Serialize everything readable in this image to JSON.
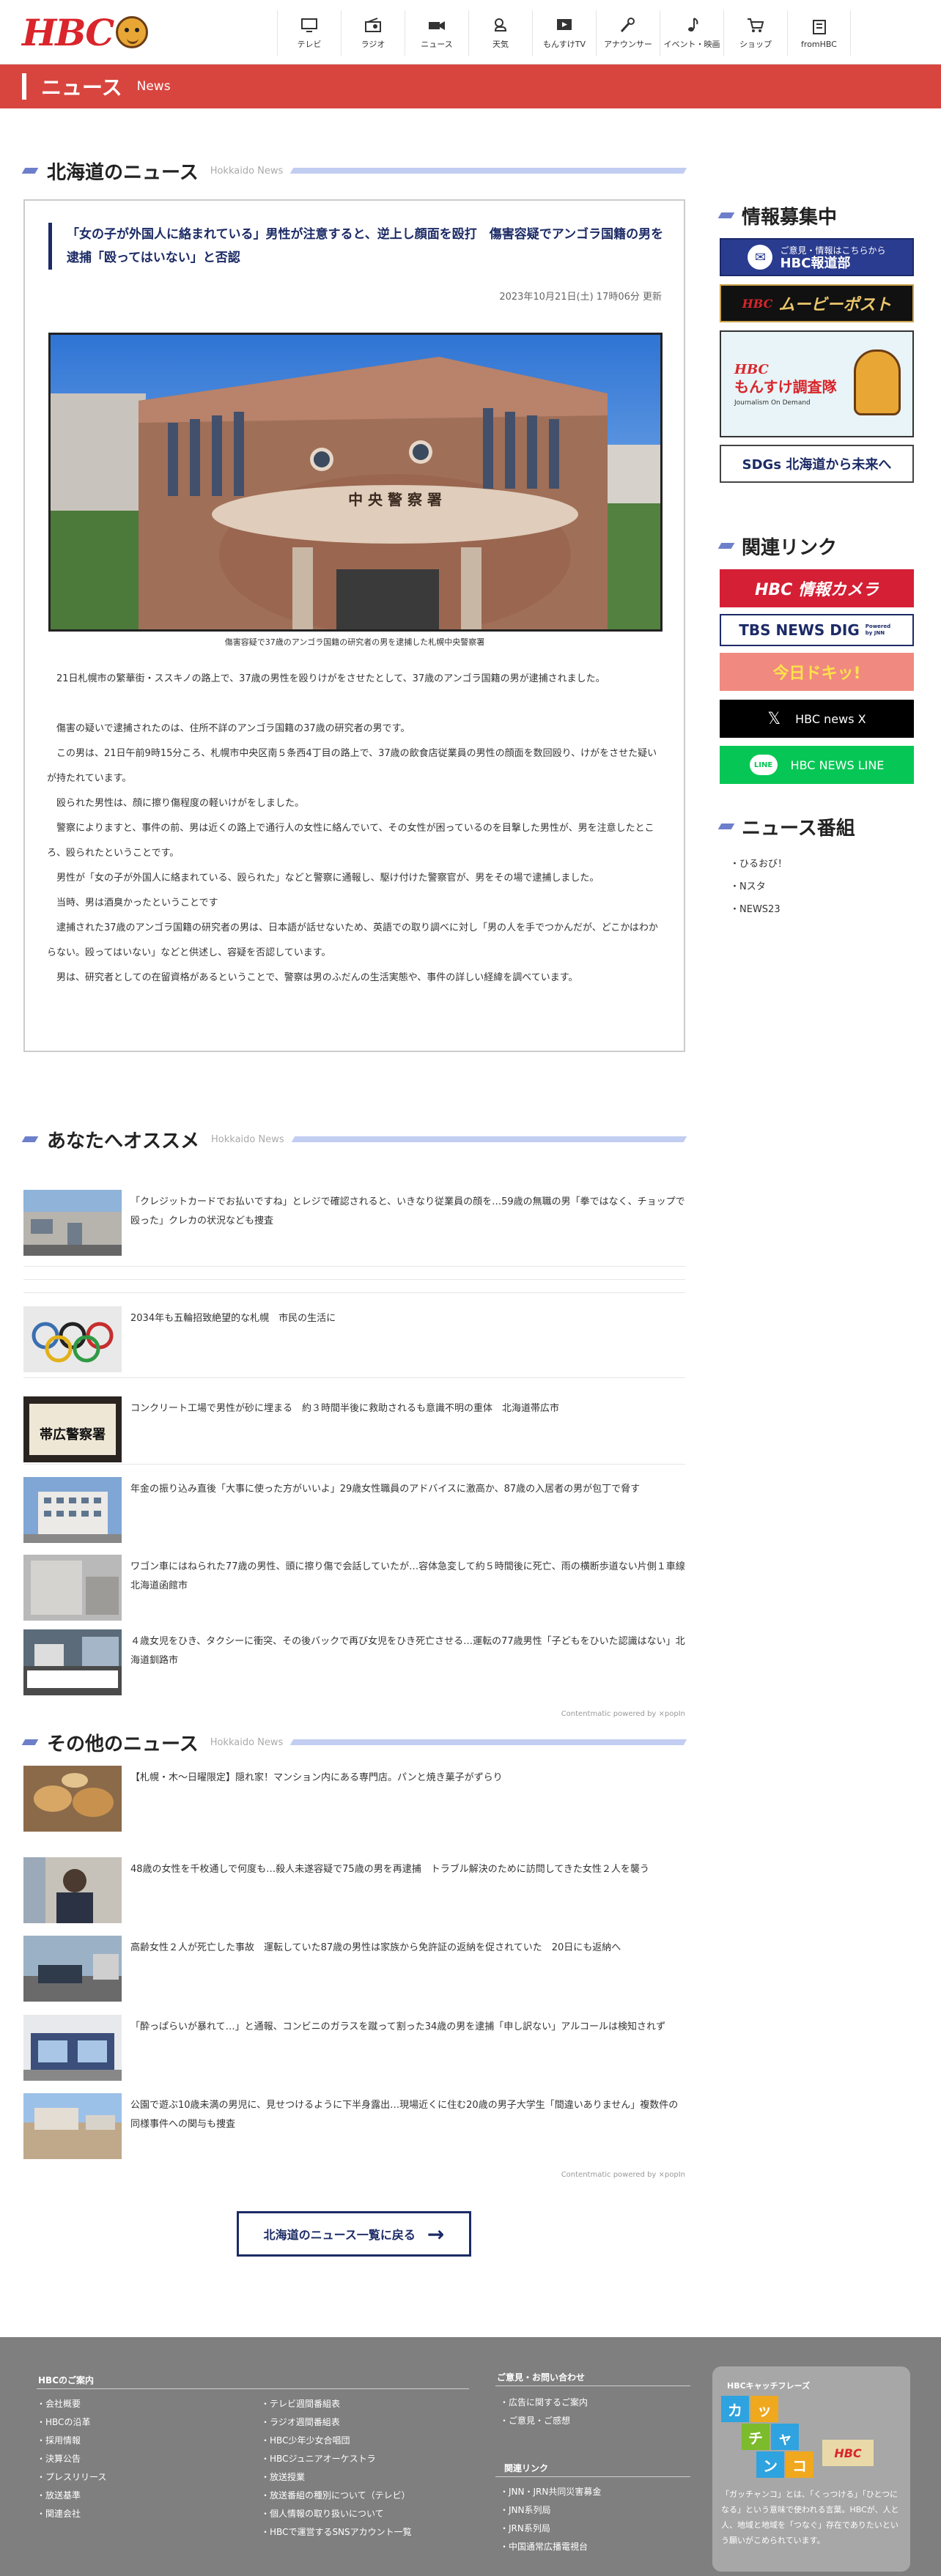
{
  "header": {
    "logo": "HBC",
    "nav": [
      {
        "label": "テレビ",
        "icon": "tv-icon"
      },
      {
        "label": "ラジオ",
        "icon": "radio-icon"
      },
      {
        "label": "ニュース",
        "icon": "news-camera-icon"
      },
      {
        "label": "天気",
        "icon": "weather-icon"
      },
      {
        "label": "もんすけTV",
        "icon": "monsuke-tv-icon"
      },
      {
        "label": "アナウンサー",
        "icon": "microphone-icon"
      },
      {
        "label": "イベント・映画",
        "icon": "music-note-icon"
      },
      {
        "label": "ショップ",
        "icon": "shopping-cart-icon"
      },
      {
        "label": "fromHBC",
        "icon": "document-icon"
      }
    ]
  },
  "page_banner": {
    "title": "ニュース",
    "subtitle": "News"
  },
  "hokkaido_news": {
    "title": "北海道のニュース",
    "subtitle": "Hokkaido News"
  },
  "article": {
    "title": "「女の子が外国人に絡まれている」男性が注意すると、逆上し顔面を殴打　傷害容疑でアンゴラ国籍の男を逮捕「殴ってはいない」と否認",
    "date": "2023年10月21日(土) 17時06分 更新",
    "photo_sign": "中 央 警 察 署",
    "caption": "傷害容疑で37歳のアンゴラ国籍の研究者の男を逮捕した札幌中央警察署",
    "paragraphs": [
      "21日札幌市の繁華街・ススキノの路上で、37歳の男性を殴りけがをさせたとして、37歳のアンゴラ国籍の男が逮捕されました。",
      "",
      "傷害の疑いで逮捕されたのは、住所不詳のアンゴラ国籍の37歳の研究者の男です。",
      "この男は、21日午前9時15分ころ、札幌市中央区南５条西4丁目の路上で、37歳の飲食店従業員の男性の顔面を数回殴り、けがをさせた疑いが持たれています。",
      "殴られた男性は、顔に擦り傷程度の軽いけがをしました。",
      "警察によりますと、事件の前、男は近くの路上で通行人の女性に絡んでいて、その女性が困っているのを目撃した男性が、男を注意したところ、殴られたということです。",
      "男性が「女の子が外国人に絡まれている、殴られた」などと警察に通報し、駆け付けた警察官が、男をその場で逮捕しました。",
      "当時、男は酒臭かったということです",
      "逮捕された37歳のアンゴラ国籍の研究者の男は、日本語が話せないため、英語での取り調べに対し「男の人を手でつかんだが、どこかはわからない。殴ってはいない」などと供述し、容疑を否認しています。",
      "男は、研究者としての在留資格があるということで、警察は男のふだんの生活実態や、事件の詳しい経緯を調べています。"
    ]
  },
  "recommend": {
    "title": "あなたへオススメ",
    "subtitle": "Hokkaido News",
    "powered": "Contentmatic powered by ⨯popIn",
    "items": [
      {
        "text": "「クレジットカードでお払いですね」とレジで確認されると、いきなり従業員の顔を…59歳の無職の男「拳ではなく、チョップで殴った」クレカの状況なども捜査"
      },
      {
        "text": "2034年も五輪招致絶望的な札幌　市民の生活に"
      },
      {
        "text": "コンクリート工場で男性が砂に埋まる　約３時間半後に救助されるも意識不明の重体　北海道帯広市",
        "sign": "帯広警察署"
      },
      {
        "text": "年金の振り込み直後「大事に使った方がいいよ」29歳女性職員のアドバイスに激高か、87歳の入居者の男が包丁で脅す"
      },
      {
        "text": "ワゴン車にはねられた77歳の男性、頭に擦り傷で会話していたが…容体急変して約５時間後に死亡、雨の横断歩道ない片側１車線　北海道函館市"
      },
      {
        "text": "４歳女児をひき、タクシーに衝突、その後バックで再び女児をひき死亡させる…運転の77歳男性「子どもをひいた認識はない」北海道釧路市"
      }
    ]
  },
  "other_news": {
    "title": "その他のニュース",
    "subtitle": "Hokkaido News",
    "powered": "Contentmatic powered by ⨯popIn",
    "items": [
      {
        "text": "【札幌・木〜日曜限定】隠れ家！マンション内にある専門店。パンと焼き菓子がずらり"
      },
      {
        "text": "48歳の女性を千枚通しで何度も…殺人未遂容疑で75歳の男を再逮捕　トラブル解決のために訪問してきた女性２人を襲う"
      },
      {
        "text": "高齢女性２人が死亡した事故　運転していた87歳の男性は家族から免許証の返納を促されていた　20日にも返納へ"
      },
      {
        "text": "「酔っぱらいが暴れて…」と通報、コンビニのガラスを蹴って割った34歳の男を逮捕「申し訳ない」アルコールは検知されず"
      },
      {
        "text": "公園で遊ぶ10歳未満の男児に、見せつけるように下半身露出…現場近くに住む20歳の男子大学生「間違いありません」複数件の同様事件への関与も捜査"
      }
    ]
  },
  "back_button": {
    "label": "北海道のニュース一覧に戻る",
    "arrow": "→"
  },
  "sidebar": {
    "info_title": "情報募集中",
    "info_banners": [
      {
        "line1": "ご意見・情報はこちらから",
        "line2": "HBC報道部"
      },
      {
        "line1": "HBC",
        "line2": "ムービーポスト"
      },
      {
        "line1": "HBC",
        "line2": "もんすけ調査隊",
        "line3": "Journalism On Demand"
      },
      {
        "line1": "SDGs 北海道から未来へ"
      }
    ],
    "links_title": "関連リンク",
    "links": [
      {
        "label": "HBC 情報カメラ"
      },
      {
        "label": "TBS NEWS DIG",
        "sub": "Powered by JNN"
      },
      {
        "label": "今日ドキッ!"
      },
      {
        "label": "HBC news X",
        "icon": "x-logo-icon"
      },
      {
        "label": "HBC NEWS LINE",
        "icon": "line-logo-icon",
        "badge": "LINE"
      }
    ],
    "programs_title": "ニュース番組",
    "programs": [
      "ひるおび！",
      "Nスタ",
      "NEWS23"
    ]
  },
  "footer": {
    "col1_title": "HBCのご案内",
    "col1": [
      "会社概要",
      "HBCの沿革",
      "採用情報",
      "決算公告",
      "プレスリリース",
      "放送基準",
      "関連会社"
    ],
    "col2": [
      "テレビ週間番組表",
      "ラジオ週間番組表",
      "HBC少年少女合唱団",
      "HBCジュニアオーケストラ",
      "放送授業",
      "放送番組の種別について（テレビ）",
      "個人情報の取り扱いについて",
      "HBCで運営するSNSアカウント一覧"
    ],
    "col3_title": "ご意見・お問い合わせ",
    "col3": [
      "広告に関するご案内",
      "ご意見・ご感想"
    ],
    "col4_title": "関連リンク",
    "col4": [
      "JNN・JRN共同災害募金",
      "JNN系列局",
      "JRN系列局",
      "中国通常広播電視台"
    ],
    "catch_title": "HBCキャッチフレーズ",
    "catch_tiles": [
      "カ",
      "ッ",
      "チ",
      "ャ",
      "ン",
      "コ",
      "HBC"
    ],
    "catch_text": "「ガッチャンコ」とは、「くっつける」「ひとつになる」という意味で使われる言葉。HBCが、人と人、地域と地域を「つなぐ」存在でありたいという願いがこめられています。"
  },
  "colors": {
    "brand_red": "#d9252b",
    "banner_red": "#d8453f",
    "navy": "#1c2b66",
    "accent_blue": "#6d7fca"
  }
}
